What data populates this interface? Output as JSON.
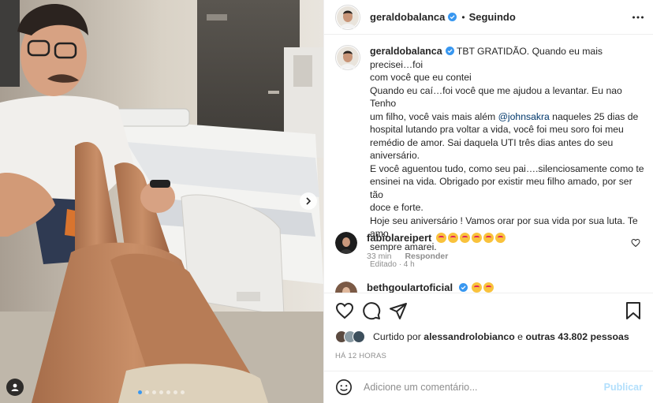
{
  "post": {
    "username": "geraldobalanca",
    "follow_separator": "•",
    "follow_label": "Seguindo",
    "caption": {
      "username": "geraldobalanca",
      "lines": [
        "TBT GRATIDÃO. Quando eu mais precisei…foi",
        "com você que eu contei",
        "Quando eu caí…foi você que me ajudou a levantar. Eu nao Tenho",
        "um filho, você vais mais além ",
        " naqueles 25 dias de",
        "hospital lutando pra voltar a vida, você foi meu soro foi meu",
        "remédio de amor. Sai daquela UTI três dias antes do seu",
        "aniversário.",
        "E você aguentou tudo, como seu pai….silenciosamente como te",
        "ensinei na vida. Obrigado por existir meu filho amado, por ser tão",
        "doce e forte.",
        "Hoje seu aniversário ! Vamos orar por sua vida por sua luta. Te amo",
        "sempre amarei."
      ],
      "mention": "@johnsakra",
      "edited": "Editado · 4 h"
    },
    "comments": [
      {
        "username": "fabiolareipert",
        "time": "33 min",
        "reply": "Responder",
        "emoji_count": 6
      },
      {
        "username": "bethgoulartoficial",
        "time": "",
        "reply": "",
        "emoji_count": 2
      }
    ],
    "likes": {
      "prefix": "Curtido por ",
      "user": "alessandrolobianco",
      "middle": " e ",
      "others": "outras 43.802 pessoas"
    },
    "time_ago": "HÁ 12 HORAS",
    "carousel": {
      "total": 7,
      "active": 0
    }
  },
  "composer": {
    "placeholder": "Adicione um comentário...",
    "publish_label": "Publicar"
  },
  "colors": {
    "verified": "#3897f0",
    "mention": "#00376b",
    "publish_disabled": "#b2dffc",
    "muted": "#8e8e8e"
  },
  "icons": [
    "verified-icon",
    "more-options-icon",
    "heart-icon",
    "comment-icon",
    "share-icon",
    "bookmark-icon",
    "emoji-icon",
    "chevron-right-icon",
    "user-tag-icon"
  ]
}
